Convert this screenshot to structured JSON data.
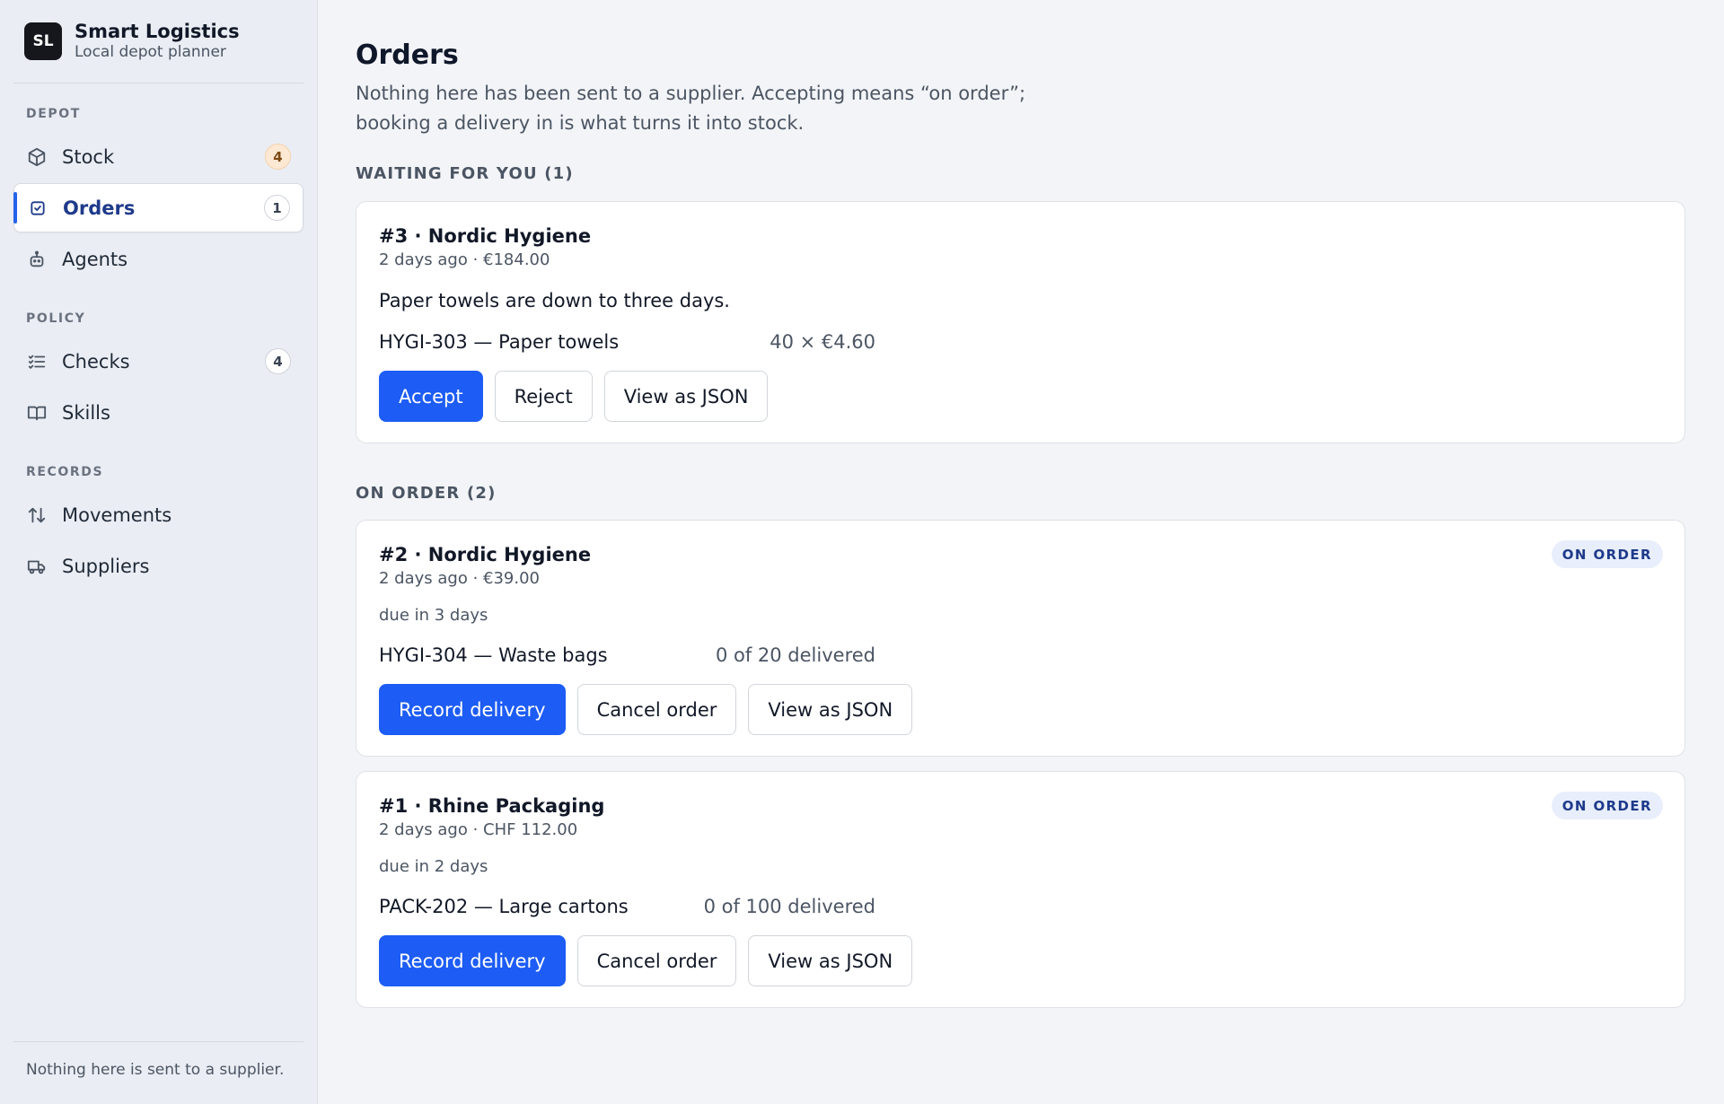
{
  "brand": {
    "logo": "SL",
    "title": "Smart Logistics",
    "subtitle": "Local depot planner"
  },
  "sidebar": {
    "sections": [
      {
        "label": "DEPOT",
        "items": [
          {
            "label": "Stock",
            "icon": "box-icon",
            "count": "4"
          },
          {
            "label": "Orders",
            "icon": "clipboard-check-icon",
            "count": "1",
            "active": true
          },
          {
            "label": "Agents",
            "icon": "robot-icon"
          }
        ]
      },
      {
        "label": "POLICY",
        "items": [
          {
            "label": "Checks",
            "icon": "checklist-icon",
            "count": "4"
          },
          {
            "label": "Skills",
            "icon": "book-icon"
          }
        ]
      },
      {
        "label": "RECORDS",
        "items": [
          {
            "label": "Movements",
            "icon": "arrows-up-down-icon"
          },
          {
            "label": "Suppliers",
            "icon": "truck-icon"
          }
        ]
      }
    ],
    "footer": "Nothing here is sent to a supplier."
  },
  "page": {
    "title": "Orders",
    "description": "Nothing here has been sent to a supplier. Accepting means “on order”; booking a delivery in is what turns it into stock."
  },
  "waiting": {
    "label": "WAITING FOR YOU (1)",
    "cards": [
      {
        "title": "#3 · Nordic Hygiene",
        "meta": "2 days ago · €184.00",
        "note": "Paper towels are down to three days.",
        "line_item": "HYGI-303 — Paper towels",
        "line_qty": "40 × €4.60",
        "actions": {
          "accept": "Accept",
          "reject": "Reject",
          "json": "View as JSON"
        }
      }
    ]
  },
  "on_order": {
    "label": "ON ORDER (2)",
    "cards": [
      {
        "title": "#2 · Nordic Hygiene",
        "meta": "2 days ago · €39.00",
        "badge": "ON ORDER",
        "due": "due in 3 days",
        "line_item": "HYGI-304 — Waste bags",
        "line_qty": "0 of 20 delivered",
        "actions": {
          "record": "Record delivery",
          "cancel": "Cancel order",
          "json": "View as JSON"
        }
      },
      {
        "title": "#1 · Rhine Packaging",
        "meta": "2 days ago · CHF 112.00",
        "badge": "ON ORDER",
        "due": "due in 2 days",
        "line_item": "PACK-202 — Large cartons",
        "line_qty": "0 of 100 delivered",
        "actions": {
          "record": "Record delivery",
          "cancel": "Cancel order",
          "json": "View as JSON"
        }
      }
    ]
  },
  "colors": {
    "accent": "#1d5cf5",
    "active_nav": "#1e3a8a",
    "sidebar_bg": "#eaedf3",
    "page_bg": "#f3f4f7"
  }
}
